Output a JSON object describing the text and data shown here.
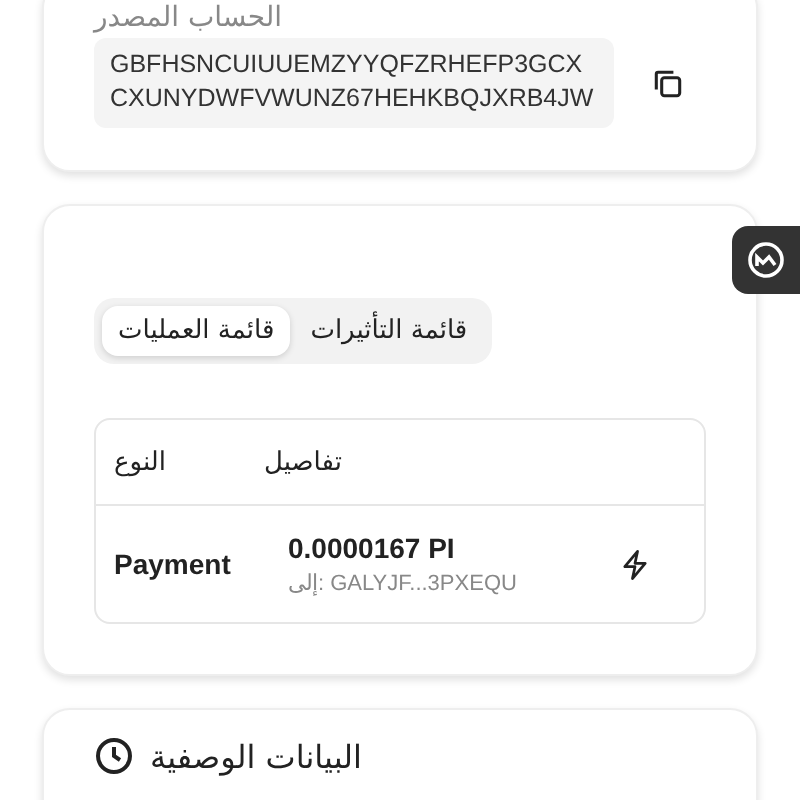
{
  "source_account": {
    "label": "الحساب المصدر",
    "value": "GBFHSNCUIUUEMZYYQFZRHEFP3GCXCXUNYDWFVWUNZ67HEHKBQJXRB4JW"
  },
  "tabs": [
    {
      "label": "قائمة التأثيرات",
      "selected": false
    },
    {
      "label": "قائمة العمليات",
      "selected": true
    }
  ],
  "operations_table": {
    "columns": [
      "تفاصيل",
      "النوع"
    ],
    "rows": [
      {
        "type": "Payment",
        "amount": "0.0000167 PI",
        "destination": "إلى: GALYJF...3PXEQU"
      }
    ]
  },
  "metadata": {
    "title": "البيانات الوصفية"
  }
}
